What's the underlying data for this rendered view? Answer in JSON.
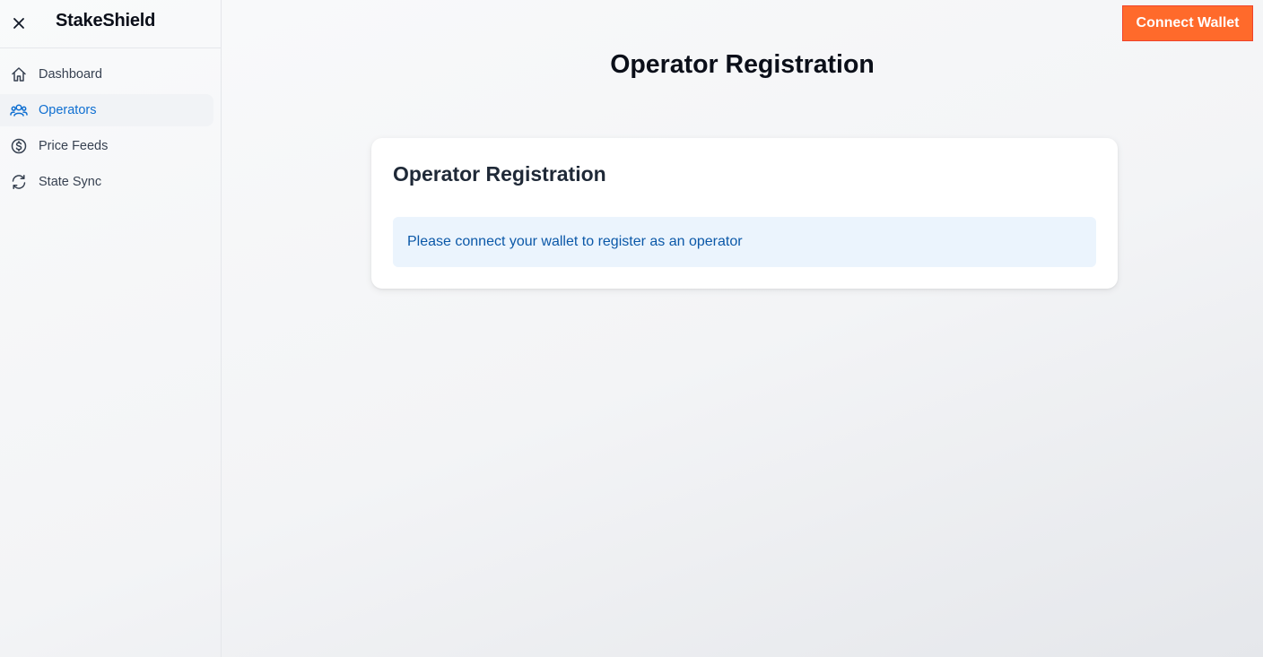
{
  "sidebar": {
    "brand": "StakeShield",
    "items": [
      {
        "label": "Dashboard",
        "icon": "home-icon",
        "active": false
      },
      {
        "label": "Operators",
        "icon": "users-icon",
        "active": true
      },
      {
        "label": "Price Feeds",
        "icon": "dollar-circle-icon",
        "active": false
      },
      {
        "label": "State Sync",
        "icon": "refresh-icon",
        "active": false
      }
    ]
  },
  "header": {
    "connect_label": "Connect Wallet"
  },
  "main": {
    "page_title": "Operator Registration",
    "card": {
      "title": "Operator Registration",
      "alert_text": "Please connect your wallet to register as an operator"
    }
  },
  "colors": {
    "accent": "#ff6a2b",
    "active_nav": "#0f6fd1",
    "alert_bg": "#ebf4fd",
    "alert_text": "#0b58a8"
  }
}
